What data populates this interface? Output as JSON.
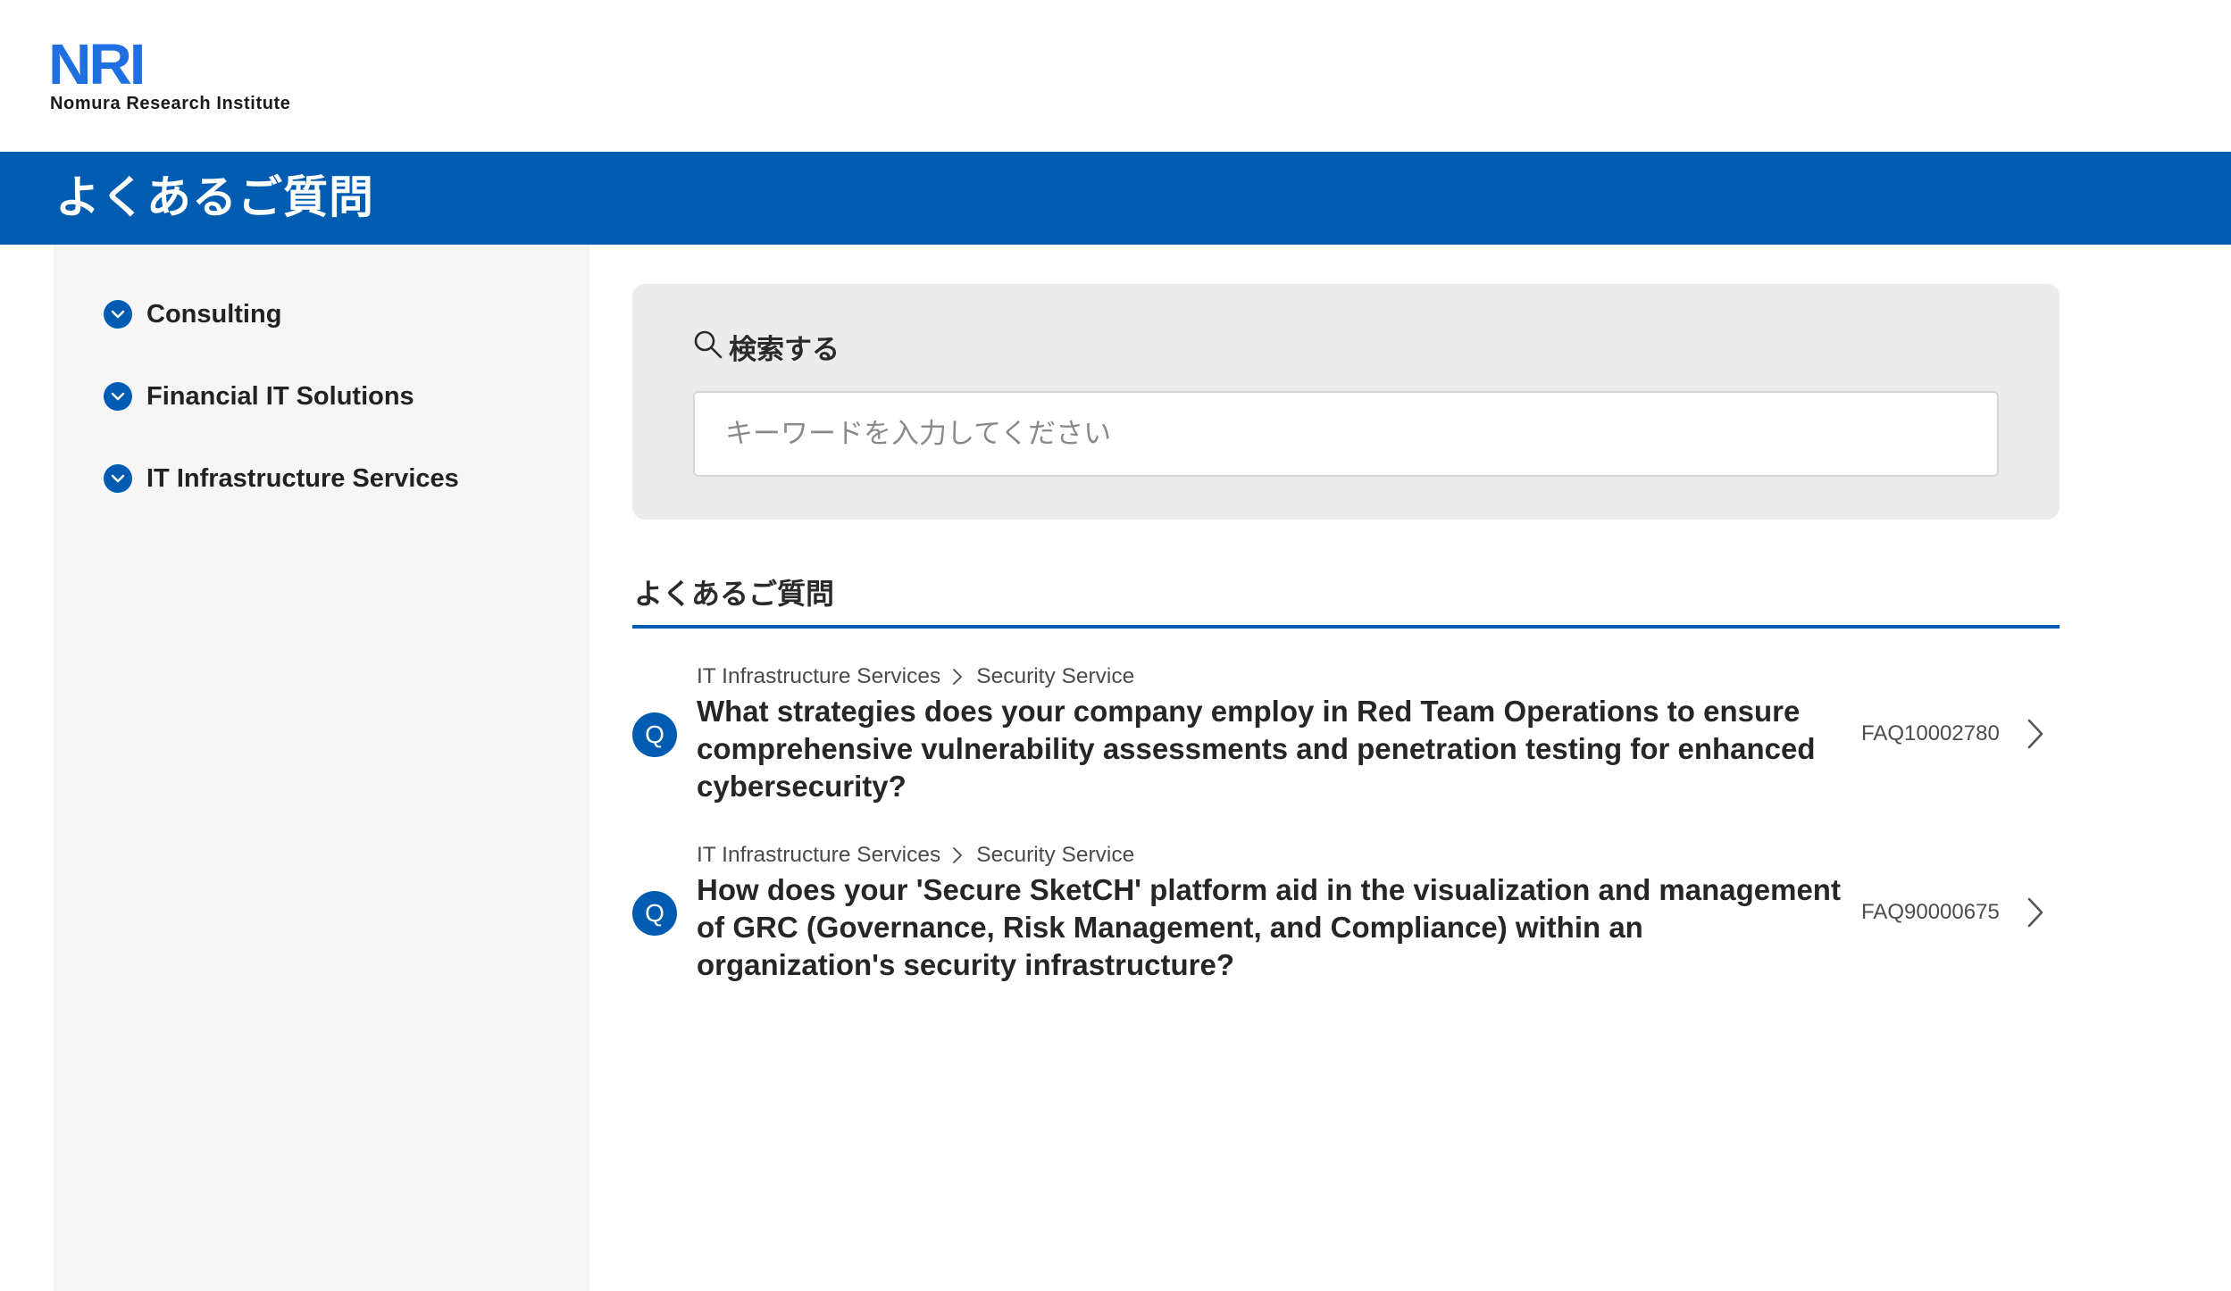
{
  "header": {
    "logo_mark": "NRI",
    "logo_subtitle": "Nomura Research Institute",
    "brand_color": "#1f6fe0"
  },
  "title_band": {
    "title": "よくあるご質問",
    "background": "#005cb0"
  },
  "sidebar": {
    "items": [
      {
        "label": "Consulting",
        "icon": "chevron-down-icon"
      },
      {
        "label": "Financial IT Solutions",
        "icon": "chevron-down-icon"
      },
      {
        "label": "IT Infrastructure Services",
        "icon": "chevron-down-icon"
      }
    ]
  },
  "search": {
    "heading": "検索する",
    "icon": "search-icon",
    "placeholder": "キーワードを入力してください",
    "value": ""
  },
  "faq": {
    "heading": "よくあるご質問",
    "badge": "Q",
    "items": [
      {
        "breadcrumb": [
          "IT Infrastructure Services",
          "Security Service"
        ],
        "question": "What strategies does your company employ in Red Team Operations to ensure comprehensive vulnerability assessments and penetration testing for enhanced cybersecurity?",
        "id": "FAQ10002780"
      },
      {
        "breadcrumb": [
          "IT Infrastructure Services",
          "Security Service"
        ],
        "question": "How does your 'Secure SketCH' platform aid in the visualization and management of GRC (Governance, Risk Management, and Compliance) within an organization's security infrastructure?",
        "id": "FAQ90000675"
      }
    ]
  },
  "colors": {
    "accent": "#005cb0",
    "sidebar_bg": "#f6f6f6",
    "search_panel_bg": "#ececec"
  }
}
